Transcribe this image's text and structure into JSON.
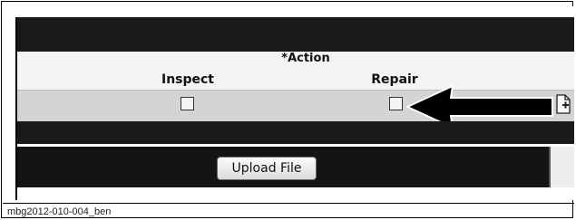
{
  "table": {
    "action_header": "*Action",
    "columns": [
      "Inspect",
      "Repair"
    ]
  },
  "checkboxes": {
    "inspect_checked": false,
    "repair_checked": false
  },
  "upload": {
    "button_label": "Upload File"
  },
  "annotation": {
    "arrow_icon": "arrow-left-icon",
    "attach_icon": "attach-document-icon"
  },
  "figure": {
    "caption": "mbg2012-010-004_ben"
  },
  "colors": {
    "dark_bar": "#1a1a1a",
    "row_bg": "#d4d4d4",
    "header_bg": "#f4f4f4"
  }
}
